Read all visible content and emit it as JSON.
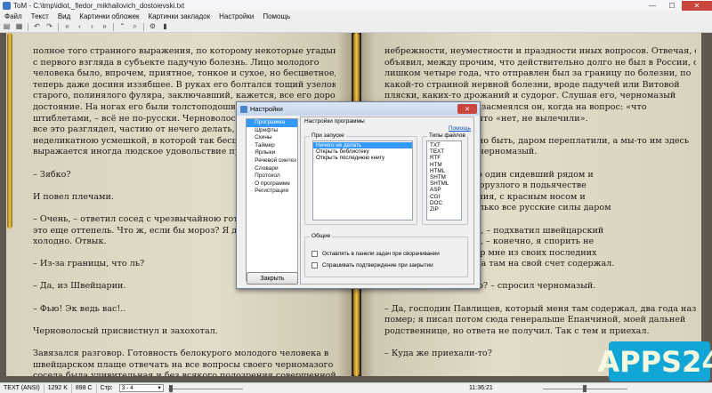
{
  "window": {
    "title": "ToM - C:\\tmp\\idiot,_fiedor_mikhailovich_dostoievski.txt",
    "minimize": "—",
    "maximize": "☐",
    "close": "✕"
  },
  "menu": [
    "Файл",
    "Текст",
    "Вид",
    "Картинки обложек",
    "Картинки закладок",
    "Настройки",
    "Помощь"
  ],
  "toolbar": {
    "icons": [
      "open-icon",
      "book-icon",
      "back-icon",
      "forward-icon",
      "first-icon",
      "previous-icon",
      "next-icon",
      "last-icon",
      "up-icon",
      "search-icon",
      "settings-icon",
      "bookmark-icon"
    ],
    "glyphs": [
      "▤",
      "▦",
      "↶",
      "↷",
      "«",
      "‹",
      "›",
      "»",
      "⌃",
      "⌕",
      "⚙",
      "▮"
    ]
  },
  "book": {
    "left_page": [
      "полное того странного выражения, по которому некоторые угадывают",
      "с первого взгляда в субъекте падучую болезнь.   Лицо молодого",
      "человека было, впрочем, приятное, тонкое и сухое, но бесцветное, а",
      "теперь даже досиня иззябшее. В руках его болтался тощий узелок из",
      "старого, полинялого фуляра, заключавший, кажется, все его дорожное",
      "достояние.   На   ногах   его   были   толстоподошвенные   башмаки   с",
      "штиблетами, – всё не по-русски. Черноволосый сосед в",
      "все это разглядел, частию от нечего делать, и, на",
      "неделикатною усмешкой, в которой так бесцеремонно",
      "выражается иногда людское удовольствие при неудачах",
      "",
      "– Зябко?",
      "",
      "И повел плечами.",
      "",
      "– Очень, – ответил сосед с чрезвычайною готовностью,",
      "это еще оттепель. Что ж, если бы мороз? Я даже не",
      "холодно. Отвык.",
      "",
      "– Из-за границы, что ль?",
      "",
      "– Да, из Швейцарии.",
      "",
      "– Фью! Эк ведь вас!..",
      "",
      "Черноволосый             присвистнул             и             захохотал.",
      "",
      "Завязался разговор. Готовность белокурого молодого человека в",
      "швейцарском плаще отвечать на все вопросы своего черномазого",
      "соседа была удивительная и без всякого подозрения совершенной"
    ],
    "right_page": [
      "небрежности, неуместности и праздности иных вопросов. Отвечая, он",
      "объявил, между прочим, что действительно долго не был в России, с",
      "лишком четыре года, что отправлен был за границу по болезни, по",
      "какой-то странной нервной болезни, вроде падучей или Витовой",
      "пляски, каких-то дрожаний и судорог. Слушая его, черномазый",
      "усмехался; особенно засмеялся он, когда на вопрос: «что",
      "белокурый отвечал, что «нет, не вылечили».",
      "",
      "ить, денег что, должно быть, даром переплатили, а мы-то им здесь",
      "язвительно     заметил     черномазый.",
      "",
      "– ввязался в разговор один сидевший рядом и",
      "ний, нечто вроде закорузлого в подьячестве",
      "ока, сильного сложения, с красным носом и",
      "стинная правда-с, только все русские силы даром",
      "",
      "м случае ошибаетесь, – подхватил швейцарский",
      "имиряющим голосом, – конечно, я спорить не",
      "е знаю, но мой доктор мне из своих последних",
      "дал, да два почти года там на свой счет содержал.",
      "",
      "платить, что ли, было? – спросил черномазый.",
      "",
      "– Да, господин Павлищев, который меня там содержал, два года назад",
      "помер; я писал потом сюда генеральше Епанчиной, моей дальней",
      "родственнице, но ответа не получил. Так с тем и приехал.",
      "",
      "– Куда же приехали-то?"
    ]
  },
  "dialog": {
    "title": "Настройки",
    "close": "✕",
    "nav": [
      "Программа",
      "Шрифты",
      "Скины",
      "Таймер",
      "Ярлыки",
      "Речевой синтез",
      "Словари",
      "Протокол",
      "О программе",
      "Регистрация"
    ],
    "nav_selected": 0,
    "ok_button": "Закрыть",
    "panel_title": "Настройки программы",
    "help_link": "Помощь",
    "start_group": "При запуске",
    "start_options": [
      "Ничего не делать",
      "Открыть библиотеку",
      "Открыть последнюю книгу"
    ],
    "start_selected": 0,
    "types_group": "Типы файлов",
    "file_types": [
      "TXT",
      "TEXT",
      "RTF",
      "HTM",
      "HTML",
      "SHTM",
      "SHTML",
      "ASP",
      "CGI",
      "DOC",
      "ZIP"
    ],
    "common_group": "Общие",
    "checkboxes": [
      {
        "label": "Оставлять в панели задач при сворачивании",
        "checked": false
      },
      {
        "label": "Спрашивать подтверждение при закрытии",
        "checked": false
      }
    ]
  },
  "statusbar": {
    "encoding": "TEXT (ANSI)",
    "size": "1292 K",
    "chars": "898 C",
    "pages_label": "Стр:",
    "pages_value": "3 - 4",
    "time": "11:36:21",
    "position_fraction": 0.01,
    "zoom_fraction": 0.5
  },
  "watermark": "APPS24"
}
